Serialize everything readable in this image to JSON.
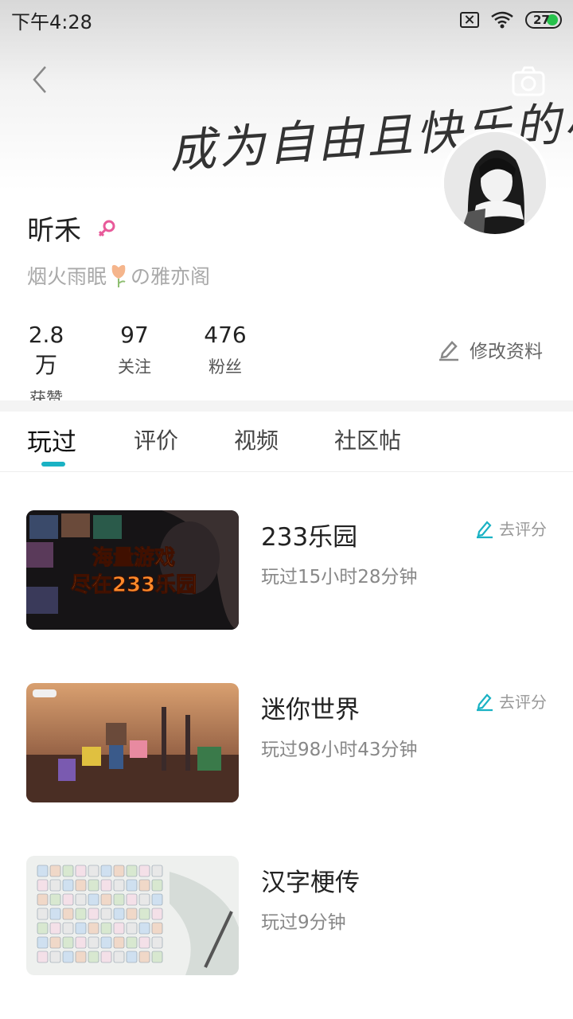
{
  "status_bar": {
    "time": "下午4:28",
    "battery": "27"
  },
  "header": {
    "signature": "成为自由且快乐的小羊"
  },
  "profile": {
    "name": "昕禾",
    "bio_prefix": "烟火雨眠",
    "bio_suffix": "の雅亦阁"
  },
  "stats": [
    {
      "value": "2.8万",
      "label": "获赞"
    },
    {
      "value": "97",
      "label": "关注"
    },
    {
      "value": "476",
      "label": "粉丝"
    }
  ],
  "edit_profile_label": "修改资料",
  "tabs": [
    "玩过",
    "评价",
    "视频",
    "社区帖"
  ],
  "games": [
    {
      "name": "233乐园",
      "time": "玩过15小时28分钟",
      "rate": "去评分",
      "thumb_line1": "海量游戏",
      "thumb_line2": "尽在233乐园"
    },
    {
      "name": "迷你世界",
      "time": "玩过98小时43分钟",
      "rate": "去评分"
    },
    {
      "name": "汉字梗传",
      "time": "玩过9分钟"
    }
  ],
  "colors": {
    "accent": "#1ab2c4",
    "female": "#e85a9a",
    "battery": "#27c24c"
  }
}
